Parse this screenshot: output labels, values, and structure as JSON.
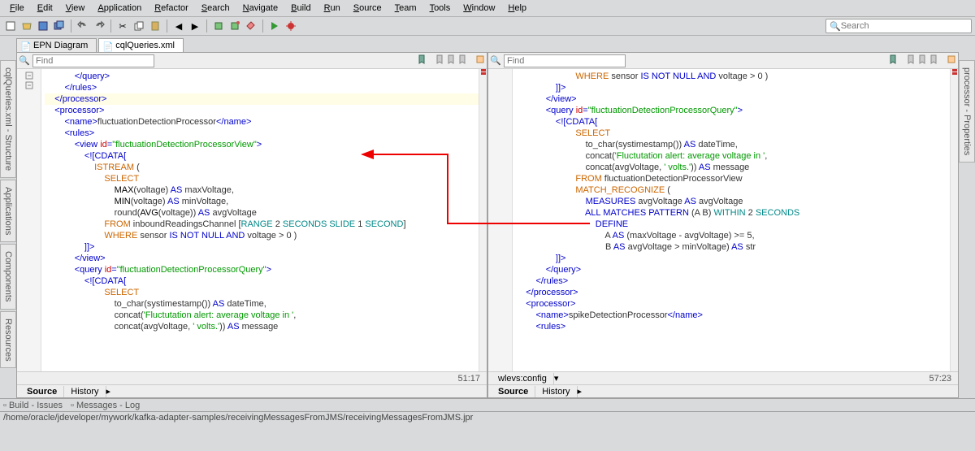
{
  "menu": {
    "items": [
      "File",
      "Edit",
      "View",
      "Application",
      "Refactor",
      "Search",
      "Navigate",
      "Build",
      "Run",
      "Source",
      "Team",
      "Tools",
      "Window",
      "Help"
    ]
  },
  "toolbar": {
    "search_placeholder": "Search"
  },
  "tabs": {
    "items": [
      {
        "label": "EPN Diagram",
        "active": false
      },
      {
        "label": "cqlQueries.xml",
        "active": true
      }
    ]
  },
  "side_left": {
    "tabs": [
      "cqlQueries.xml - Structure",
      "Applications",
      "Components",
      "Resources"
    ]
  },
  "side_right": {
    "tabs": [
      "processor - Properties"
    ]
  },
  "editors": {
    "left": {
      "find_placeholder": "Find",
      "cursor_pos": "51:17",
      "footer_tabs": [
        "Source",
        "History"
      ],
      "code_lines": [
        {
          "indent": 12,
          "parts": [
            {
              "c": "tag",
              "t": "</query>"
            }
          ]
        },
        {
          "indent": 8,
          "parts": [
            {
              "c": "tag",
              "t": "</rules>"
            }
          ]
        },
        {
          "indent": 4,
          "hl": true,
          "parts": [
            {
              "c": "tag",
              "t": "</processor>"
            }
          ]
        },
        {
          "indent": 0,
          "parts": []
        },
        {
          "indent": 4,
          "parts": [
            {
              "c": "tag",
              "t": "<processor>"
            }
          ]
        },
        {
          "indent": 8,
          "parts": [
            {
              "c": "tag",
              "t": "<name>"
            },
            {
              "c": "txt",
              "t": "fluctuationDetectionProcessor"
            },
            {
              "c": "tag",
              "t": "</name>"
            }
          ]
        },
        {
          "indent": 8,
          "parts": [
            {
              "c": "tag",
              "t": "<rules>"
            }
          ]
        },
        {
          "indent": 12,
          "parts": [
            {
              "c": "tag",
              "t": "<view "
            },
            {
              "c": "attr",
              "t": "id"
            },
            {
              "c": "tag",
              "t": "="
            },
            {
              "c": "val",
              "t": "\"fluctuationDetectionProcessorView\""
            },
            {
              "c": "tag",
              "t": ">"
            }
          ]
        },
        {
          "indent": 16,
          "parts": [
            {
              "c": "cdata",
              "t": "<![CDATA["
            }
          ]
        },
        {
          "indent": 0,
          "parts": []
        },
        {
          "indent": 20,
          "parts": [
            {
              "c": "kw2",
              "t": "ISTREAM"
            },
            {
              "c": "txt",
              "t": " ("
            }
          ]
        },
        {
          "indent": 0,
          "parts": []
        },
        {
          "indent": 24,
          "parts": [
            {
              "c": "kw2",
              "t": "SELECT"
            }
          ]
        },
        {
          "indent": 0,
          "parts": []
        },
        {
          "indent": 28,
          "parts": [
            {
              "c": "fn",
              "t": "MAX"
            },
            {
              "c": "txt",
              "t": "(voltage) "
            },
            {
              "c": "kw",
              "t": "AS"
            },
            {
              "c": "txt",
              "t": " maxVoltage,"
            }
          ]
        },
        {
          "indent": 28,
          "parts": [
            {
              "c": "fn",
              "t": "MIN"
            },
            {
              "c": "txt",
              "t": "(voltage) "
            },
            {
              "c": "kw",
              "t": "AS"
            },
            {
              "c": "txt",
              "t": " minVoltage,"
            }
          ]
        },
        {
          "indent": 28,
          "parts": [
            {
              "c": "txt",
              "t": "round("
            },
            {
              "c": "fn",
              "t": "AVG"
            },
            {
              "c": "txt",
              "t": "(voltage)) "
            },
            {
              "c": "kw",
              "t": "AS"
            },
            {
              "c": "txt",
              "t": " avgVoltage"
            }
          ]
        },
        {
          "indent": 0,
          "parts": []
        },
        {
          "indent": 24,
          "parts": [
            {
              "c": "kw2",
              "t": "FROM"
            },
            {
              "c": "txt",
              "t": " inboundReadingsChannel ["
            },
            {
              "c": "cyan",
              "t": "RANGE"
            },
            {
              "c": "txt",
              "t": " 2 "
            },
            {
              "c": "cyan",
              "t": "SECONDS SLIDE"
            },
            {
              "c": "txt",
              "t": " 1 "
            },
            {
              "c": "cyan",
              "t": "SECOND"
            },
            {
              "c": "txt",
              "t": "]"
            }
          ]
        },
        {
          "indent": 0,
          "parts": []
        },
        {
          "indent": 24,
          "parts": [
            {
              "c": "kw2",
              "t": "WHERE"
            },
            {
              "c": "txt",
              "t": " sensor "
            },
            {
              "c": "kw",
              "t": "IS NOT NULL AND"
            },
            {
              "c": "txt",
              "t": " voltage > 0 )"
            }
          ]
        },
        {
          "indent": 0,
          "parts": []
        },
        {
          "indent": 16,
          "parts": [
            {
              "c": "cdata",
              "t": "]]>"
            }
          ]
        },
        {
          "indent": 12,
          "parts": [
            {
              "c": "tag",
              "t": "</view>"
            }
          ]
        },
        {
          "indent": 12,
          "parts": [
            {
              "c": "tag",
              "t": "<query "
            },
            {
              "c": "attr",
              "t": "id"
            },
            {
              "c": "tag",
              "t": "="
            },
            {
              "c": "val",
              "t": "\"fluctuationDetectionProcessorQuery\""
            },
            {
              "c": "tag",
              "t": ">"
            }
          ]
        },
        {
          "indent": 16,
          "parts": [
            {
              "c": "cdata",
              "t": "<![CDATA["
            }
          ]
        },
        {
          "indent": 0,
          "parts": []
        },
        {
          "indent": 24,
          "parts": [
            {
              "c": "kw2",
              "t": "SELECT"
            }
          ]
        },
        {
          "indent": 0,
          "parts": []
        },
        {
          "indent": 28,
          "parts": [
            {
              "c": "txt",
              "t": "to_char(systimestamp()) "
            },
            {
              "c": "kw",
              "t": "AS"
            },
            {
              "c": "txt",
              "t": " dateTime,"
            }
          ]
        },
        {
          "indent": 28,
          "parts": [
            {
              "c": "txt",
              "t": "concat("
            },
            {
              "c": "str",
              "t": "'Fluctutation alert: average voltage in '"
            },
            {
              "c": "txt",
              "t": ","
            }
          ]
        },
        {
          "indent": 28,
          "parts": [
            {
              "c": "txt",
              "t": "concat(avgVoltage, "
            },
            {
              "c": "str",
              "t": "' volts.'"
            },
            {
              "c": "txt",
              "t": ")) "
            },
            {
              "c": "kw",
              "t": "AS"
            },
            {
              "c": "txt",
              "t": " message"
            }
          ]
        }
      ]
    },
    "right": {
      "find_placeholder": "Find",
      "cursor_pos": "57:23",
      "breadcrumb": "wlevs:config",
      "footer_tabs": [
        "Source",
        "History"
      ],
      "code_lines": [
        {
          "indent": 24,
          "parts": [
            {
              "c": "kw2",
              "t": "WHERE"
            },
            {
              "c": "txt",
              "t": " sensor "
            },
            {
              "c": "kw",
              "t": "IS NOT NULL AND"
            },
            {
              "c": "txt",
              "t": " voltage > 0 )"
            }
          ]
        },
        {
          "indent": 0,
          "parts": []
        },
        {
          "indent": 16,
          "parts": [
            {
              "c": "cdata",
              "t": "]]>"
            }
          ]
        },
        {
          "indent": 12,
          "parts": [
            {
              "c": "tag",
              "t": "</view>"
            }
          ]
        },
        {
          "indent": 12,
          "parts": [
            {
              "c": "tag",
              "t": "<query "
            },
            {
              "c": "attr",
              "t": "id"
            },
            {
              "c": "tag",
              "t": "="
            },
            {
              "c": "val",
              "t": "\"fluctuationDetectionProcessorQuery\""
            },
            {
              "c": "tag",
              "t": ">"
            }
          ]
        },
        {
          "indent": 16,
          "parts": [
            {
              "c": "cdata",
              "t": "<![CDATA["
            }
          ]
        },
        {
          "indent": 0,
          "parts": []
        },
        {
          "indent": 24,
          "parts": [
            {
              "c": "kw2",
              "t": "SELECT"
            }
          ]
        },
        {
          "indent": 0,
          "parts": []
        },
        {
          "indent": 28,
          "parts": [
            {
              "c": "txt",
              "t": "to_char(systimestamp()) "
            },
            {
              "c": "kw",
              "t": "AS"
            },
            {
              "c": "txt",
              "t": " dateTime,"
            }
          ]
        },
        {
          "indent": 28,
          "parts": [
            {
              "c": "txt",
              "t": "concat("
            },
            {
              "c": "str",
              "t": "'Fluctutation alert: average voltage in '"
            },
            {
              "c": "txt",
              "t": ","
            }
          ]
        },
        {
          "indent": 28,
          "parts": [
            {
              "c": "txt",
              "t": "concat(avgVoltage, "
            },
            {
              "c": "str",
              "t": "' volts.'"
            },
            {
              "c": "txt",
              "t": ")) "
            },
            {
              "c": "kw",
              "t": "AS"
            },
            {
              "c": "txt",
              "t": " message"
            }
          ]
        },
        {
          "indent": 0,
          "parts": []
        },
        {
          "indent": 24,
          "parts": [
            {
              "c": "kw2",
              "t": "FROM"
            },
            {
              "c": "txt",
              "t": " fluctuationDetectionProcessorView"
            }
          ]
        },
        {
          "indent": 0,
          "parts": []
        },
        {
          "indent": 24,
          "parts": [
            {
              "c": "kw2",
              "t": "MATCH_RECOGNIZE"
            },
            {
              "c": "txt",
              "t": " ("
            }
          ]
        },
        {
          "indent": 0,
          "parts": []
        },
        {
          "indent": 28,
          "parts": [
            {
              "c": "kw",
              "t": "MEASURES"
            },
            {
              "c": "txt",
              "t": " avgVoltage "
            },
            {
              "c": "kw",
              "t": "AS"
            },
            {
              "c": "txt",
              "t": " avgVoltage"
            }
          ]
        },
        {
          "indent": 0,
          "parts": []
        },
        {
          "indent": 28,
          "parts": [
            {
              "c": "kw",
              "t": "ALL MATCHES PATTERN"
            },
            {
              "c": "txt",
              "t": " (A B) "
            },
            {
              "c": "cyan",
              "t": "WITHIN"
            },
            {
              "c": "txt",
              "t": " 2 "
            },
            {
              "c": "cyan",
              "t": "SECONDS"
            }
          ]
        },
        {
          "indent": 0,
          "parts": []
        },
        {
          "indent": 32,
          "parts": [
            {
              "c": "kw",
              "t": "DEFINE"
            }
          ]
        },
        {
          "indent": 36,
          "parts": [
            {
              "c": "txt",
              "t": "A "
            },
            {
              "c": "kw",
              "t": "AS"
            },
            {
              "c": "txt",
              "t": " (maxVoltage - avgVoltage) >= 5,"
            }
          ]
        },
        {
          "indent": 36,
          "parts": [
            {
              "c": "txt",
              "t": "B "
            },
            {
              "c": "kw",
              "t": "AS"
            },
            {
              "c": "txt",
              "t": " avgVoltage > minVoltage) "
            },
            {
              "c": "kw",
              "t": "AS"
            },
            {
              "c": "txt",
              "t": " str"
            }
          ]
        },
        {
          "indent": 0,
          "parts": []
        },
        {
          "indent": 16,
          "parts": [
            {
              "c": "cdata",
              "t": "]]>"
            }
          ]
        },
        {
          "indent": 12,
          "parts": [
            {
              "c": "tag",
              "t": "</query>"
            }
          ]
        },
        {
          "indent": 8,
          "parts": [
            {
              "c": "tag",
              "t": "</rules>"
            }
          ]
        },
        {
          "indent": 4,
          "parts": [
            {
              "c": "tag",
              "t": "</processor>"
            }
          ]
        },
        {
          "indent": 0,
          "parts": []
        },
        {
          "indent": 4,
          "parts": [
            {
              "c": "tag",
              "t": "<processor>"
            }
          ]
        },
        {
          "indent": 8,
          "parts": [
            {
              "c": "tag",
              "t": "<name>"
            },
            {
              "c": "txt",
              "t": "spikeDetectionProcessor"
            },
            {
              "c": "tag",
              "t": "</name>"
            }
          ]
        },
        {
          "indent": 8,
          "parts": [
            {
              "c": "tag",
              "t": "<rules>"
            }
          ]
        }
      ]
    }
  },
  "bottom": {
    "items": [
      "Build - Issues",
      "Messages - Log"
    ]
  },
  "status": {
    "path": "/home/oracle/jdeveloper/mywork/kafka-adapter-samples/receivingMessagesFromJMS/receivingMessagesFromJMS.jpr"
  }
}
